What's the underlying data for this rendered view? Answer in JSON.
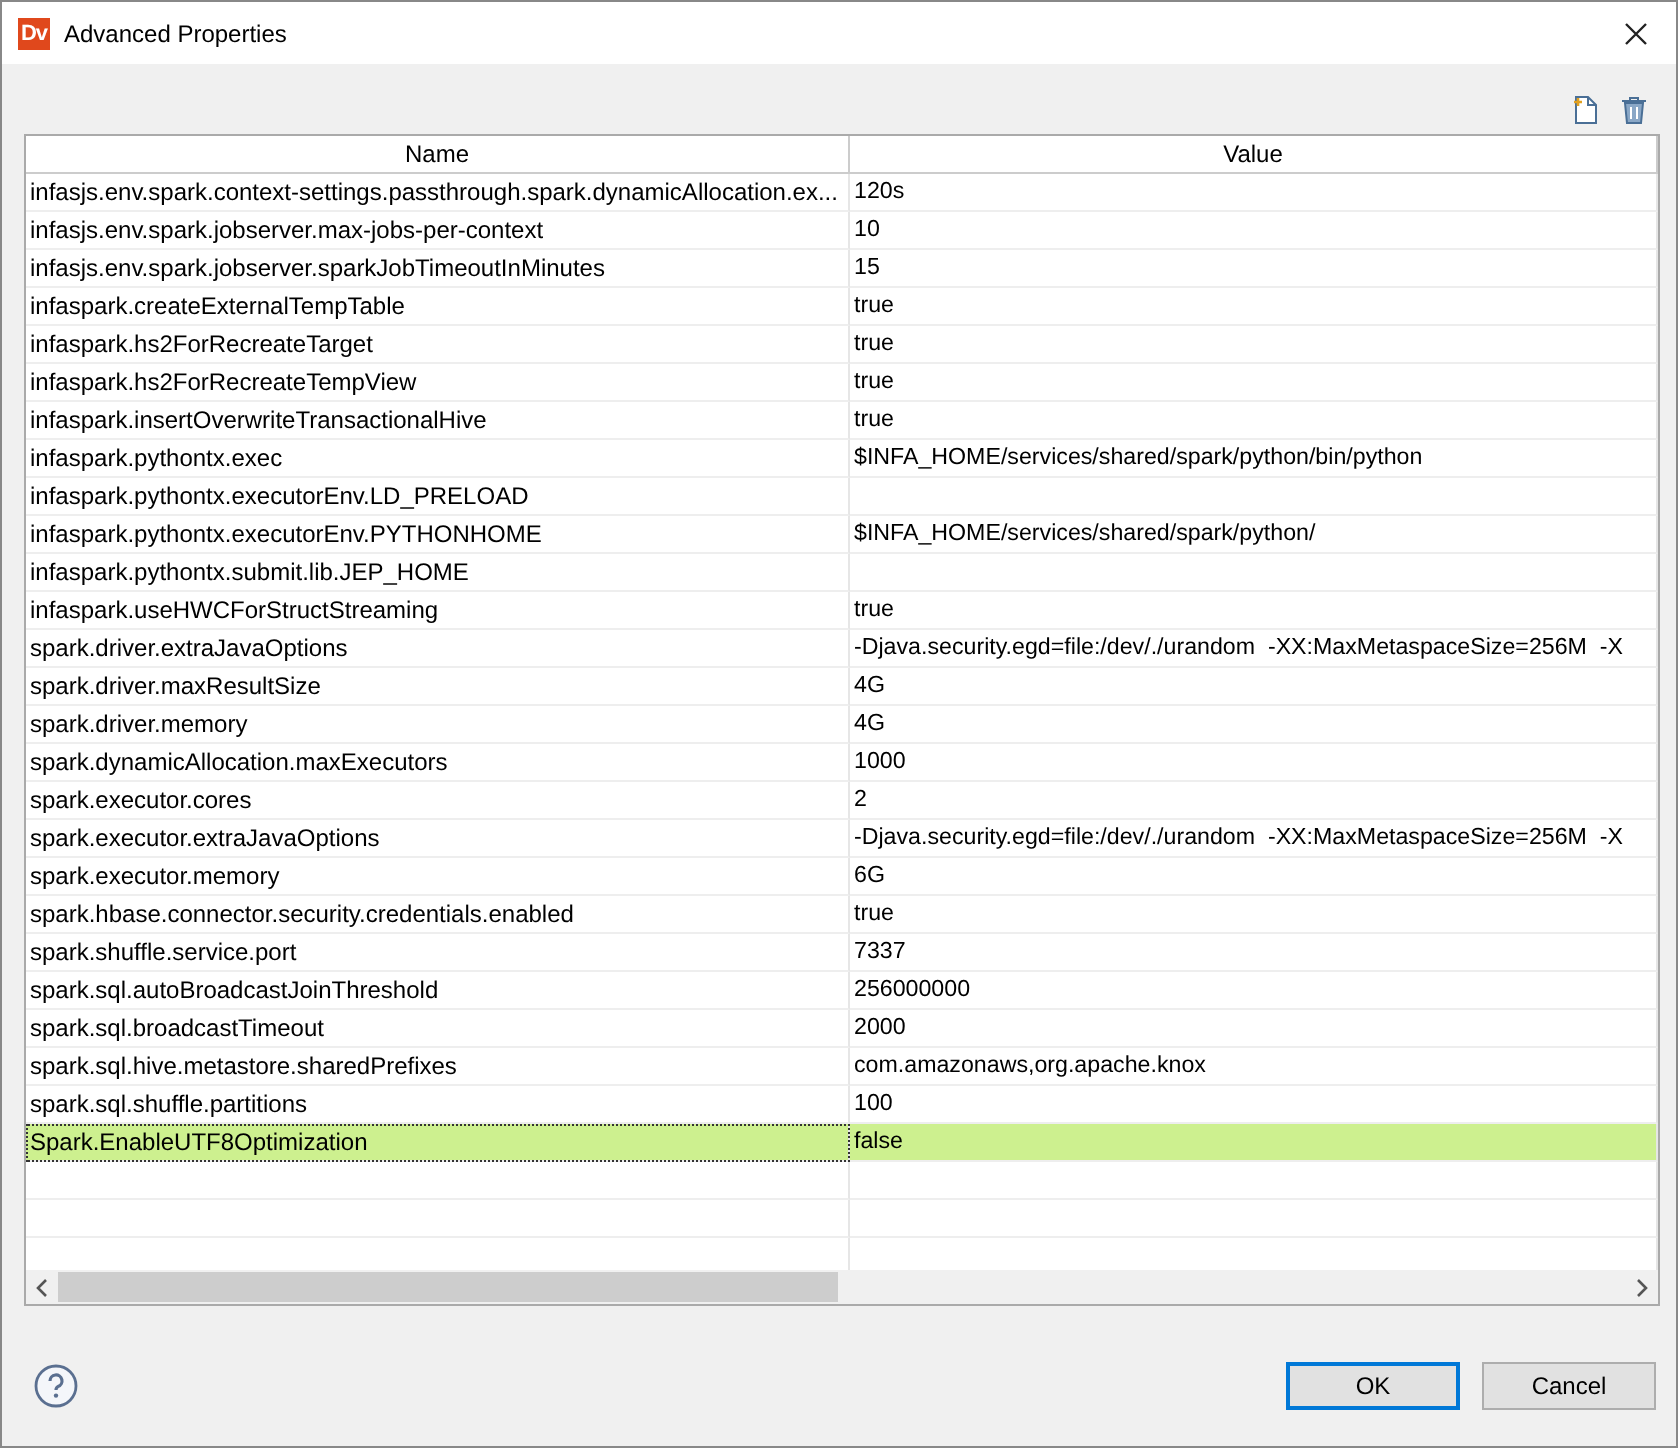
{
  "window": {
    "logo_text": "Dv",
    "title": "Advanced Properties"
  },
  "table": {
    "columns": [
      "Name",
      "Value"
    ],
    "rows": [
      {
        "name": "infasjs.env.spark.context-settings.passthrough.spark.dynamicAllocation.ex...",
        "value": "120s",
        "selected": false
      },
      {
        "name": "infasjs.env.spark.jobserver.max-jobs-per-context",
        "value": "10",
        "selected": false
      },
      {
        "name": "infasjs.env.spark.jobserver.sparkJobTimeoutInMinutes",
        "value": "15",
        "selected": false
      },
      {
        "name": "infaspark.createExternalTempTable",
        "value": "true",
        "selected": false
      },
      {
        "name": "infaspark.hs2ForRecreateTarget",
        "value": "true",
        "selected": false
      },
      {
        "name": "infaspark.hs2ForRecreateTempView",
        "value": "true",
        "selected": false
      },
      {
        "name": "infaspark.insertOverwriteTransactionalHive",
        "value": "true",
        "selected": false
      },
      {
        "name": "infaspark.pythontx.exec",
        "value": "$INFA_HOME/services/shared/spark/python/bin/python",
        "selected": false
      },
      {
        "name": "infaspark.pythontx.executorEnv.LD_PRELOAD",
        "selected": false
      },
      {
        "name": "infaspark.pythontx.executorEnv.PYTHONHOME",
        "value": "$INFA_HOME/services/shared/spark/python/",
        "selected": false
      },
      {
        "name": "infaspark.pythontx.submit.lib.JEP_HOME",
        "selected": false
      },
      {
        "name": "infaspark.useHWCForStructStreaming",
        "value": "true",
        "selected": false
      },
      {
        "name": "spark.driver.extraJavaOptions",
        "value": "-Djava.security.egd=file:/dev/./urandom  -XX:MaxMetaspaceSize=256M  -X",
        "selected": false
      },
      {
        "name": "spark.driver.maxResultSize",
        "value": "4G",
        "selected": false
      },
      {
        "name": "spark.driver.memory",
        "value": "4G",
        "selected": false
      },
      {
        "name": "spark.dynamicAllocation.maxExecutors",
        "value": "1000",
        "selected": false
      },
      {
        "name": "spark.executor.cores",
        "value": "2",
        "selected": false
      },
      {
        "name": "spark.executor.extraJavaOptions",
        "value": "-Djava.security.egd=file:/dev/./urandom  -XX:MaxMetaspaceSize=256M  -X",
        "selected": false
      },
      {
        "name": "spark.executor.memory",
        "value": "6G",
        "selected": false
      },
      {
        "name": "spark.hbase.connector.security.credentials.enabled",
        "value": "true",
        "selected": false
      },
      {
        "name": "spark.shuffle.service.port",
        "value": "7337",
        "selected": false
      },
      {
        "name": "spark.sql.autoBroadcastJoinThreshold",
        "value": "256000000",
        "selected": false
      },
      {
        "name": "spark.sql.broadcastTimeout",
        "value": "2000",
        "selected": false
      },
      {
        "name": "spark.sql.hive.metastore.sharedPrefixes",
        "value": "com.amazonaws,org.apache.knox",
        "selected": false
      },
      {
        "name": "spark.sql.shuffle.partitions",
        "value": "100",
        "selected": false
      },
      {
        "name": "Spark.EnableUTF8Optimization",
        "value": "false",
        "selected": true
      }
    ]
  },
  "buttons": [
    {
      "label": "OK",
      "kind": "default"
    },
    {
      "label": "Cancel",
      "kind": "normal"
    }
  ]
}
